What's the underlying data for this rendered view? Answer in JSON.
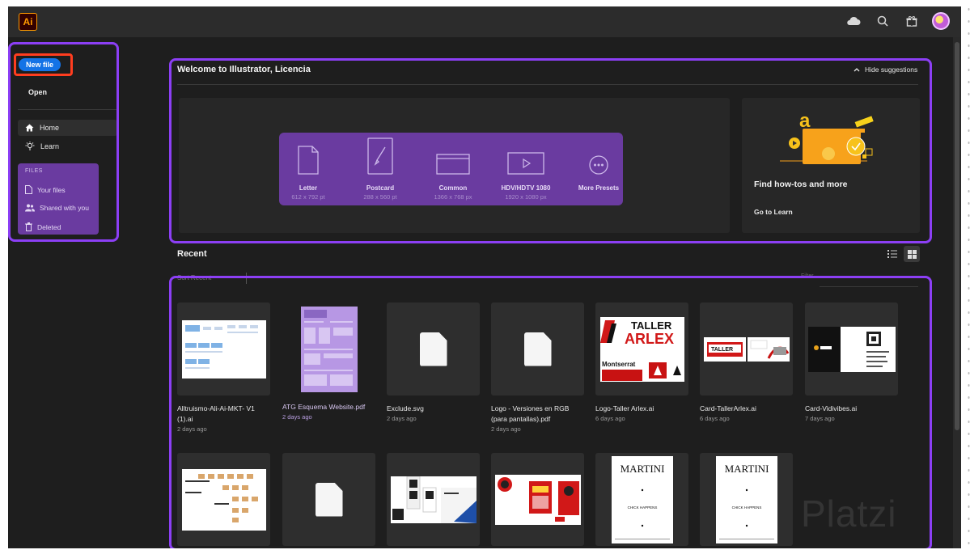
{
  "app": {
    "logo_text": "Ai"
  },
  "topbar": {
    "icons": [
      "cloud-icon",
      "search-icon",
      "gift-icon",
      "avatar"
    ]
  },
  "sidebar": {
    "new_file": "New file",
    "open": "Open",
    "nav": [
      {
        "label": "Home",
        "icon": "home-icon"
      },
      {
        "label": "Learn",
        "icon": "lightbulb-icon"
      }
    ],
    "files_heading": "FILES",
    "files": [
      {
        "label": "Your files",
        "icon": "file-icon"
      },
      {
        "label": "Shared with you",
        "icon": "people-icon"
      },
      {
        "label": "Deleted",
        "icon": "trash-icon"
      }
    ]
  },
  "welcome": {
    "title": "Welcome to Illustrator, Licencia",
    "hide_suggestions": "Hide suggestions",
    "presets": [
      {
        "label": "Letter",
        "dims": "612 x 792 pt",
        "icon": "document-icon"
      },
      {
        "label": "Postcard",
        "dims": "288 x 560 pt",
        "icon": "brush-icon"
      },
      {
        "label": "Common",
        "dims": "1366 x 768 px",
        "icon": "browser-window-icon"
      },
      {
        "label": "HDV/HDTV 1080",
        "dims": "1920 x 1080 px",
        "icon": "video-play-icon"
      },
      {
        "label": "More Presets",
        "dims": "",
        "icon": "more-icon"
      }
    ],
    "learn": {
      "title": "Find how-tos and more",
      "link": "Go to Learn"
    }
  },
  "recent": {
    "title": "Recent",
    "sort_text": "Sort     Recent",
    "filter_text": "Filter",
    "files": [
      {
        "name": "Alltruismo-Ali-Ai-MKT- V1 (1).ai",
        "age": "2 days ago",
        "thumb": "web-grid"
      },
      {
        "name": "ATG Esquema Website.pdf",
        "age": "2 days ago",
        "thumb": "pdf-page",
        "selected": true
      },
      {
        "name": "Exclude.svg",
        "age": "2 days ago",
        "thumb": "blank"
      },
      {
        "name": "Logo - Versiones en RGB (para pantallas).pdf",
        "age": "2 days ago",
        "thumb": "blank"
      },
      {
        "name": "Logo-Taller Arlex.ai",
        "age": "6 days ago",
        "thumb": "arlex"
      },
      {
        "name": "Card-TallerArlex.ai",
        "age": "6 days ago",
        "thumb": "arlex-card"
      },
      {
        "name": "Card-Vidivibes.ai",
        "age": "7 days ago",
        "thumb": "vidivibes"
      },
      {
        "name": "",
        "age": "",
        "thumb": "board"
      },
      {
        "name": "",
        "age": "",
        "thumb": "blank"
      },
      {
        "name": "",
        "age": "",
        "thumb": "qr-cards"
      },
      {
        "name": "",
        "age": "",
        "thumb": "red-poster"
      },
      {
        "name": "",
        "age": "",
        "thumb": "martini"
      },
      {
        "name": "",
        "age": "",
        "thumb": "martini"
      }
    ],
    "arlex_text": [
      "TALLER",
      "ARLEX",
      "Montserrat"
    ],
    "martini_text": [
      "MARTINI",
      "CHICK HAPPENS"
    ]
  },
  "watermark": "Platzi",
  "colors": {
    "accent": "#8c3ff5",
    "highlight_red": "#ff3d1f",
    "primary_blue": "#1473e6",
    "purple_fill": "#6a3ba0"
  }
}
